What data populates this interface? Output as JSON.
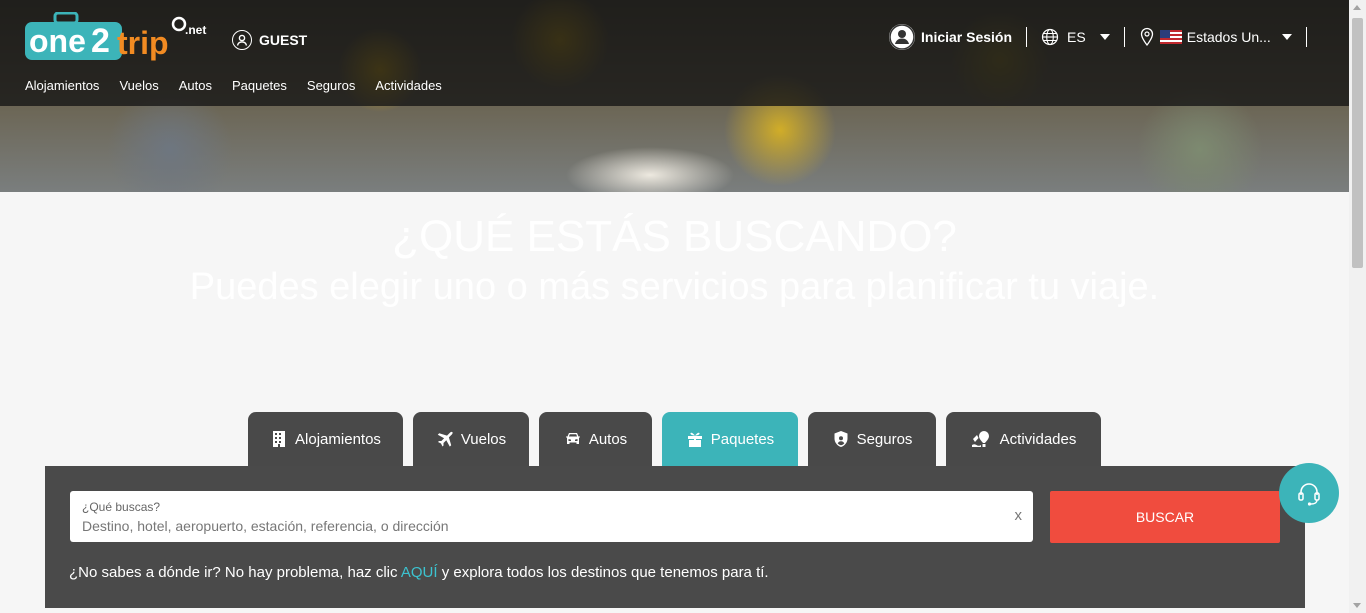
{
  "brand": {
    "logo_text": "one2trip",
    "logo_suffix": ".net"
  },
  "header": {
    "guest_label": "GUEST",
    "login_label": "Iniciar Sesión",
    "language": "ES",
    "country": "Estados Un..."
  },
  "nav": {
    "items": [
      {
        "label": "Alojamientos"
      },
      {
        "label": "Vuelos"
      },
      {
        "label": "Autos"
      },
      {
        "label": "Paquetes"
      },
      {
        "label": "Seguros"
      },
      {
        "label": "Actividades"
      }
    ]
  },
  "hero": {
    "title": "¿QUÉ ESTÁS BUSCANDO?",
    "subtitle": "Puedes elegir uno o más servicios para planificar tu viaje."
  },
  "tabs": [
    {
      "label": "Alojamientos",
      "icon": "building-icon"
    },
    {
      "label": "Vuelos",
      "icon": "plane-icon"
    },
    {
      "label": "Autos",
      "icon": "car-icon"
    },
    {
      "label": "Paquetes",
      "icon": "gift-icon",
      "active": true
    },
    {
      "label": "Seguros",
      "icon": "shield-icon"
    },
    {
      "label": "Actividades",
      "icon": "balloon-icon"
    }
  ],
  "search": {
    "label": "¿Qué buscas?",
    "placeholder": "Destino, hotel, aeropuerto, estación, referencia, o dirección",
    "value": "",
    "clear": "x",
    "button": "BUSCAR"
  },
  "explore": {
    "before": "¿No sabes a dónde ir? No hay problema, haz clic ",
    "link": "AQUÍ",
    "after": " y explora todos los destinos que tenemos para tí."
  },
  "colors": {
    "accent": "#3cb4b9",
    "button": "#f04c3e",
    "panel": "#4a4a4a",
    "tab": "#494949"
  }
}
